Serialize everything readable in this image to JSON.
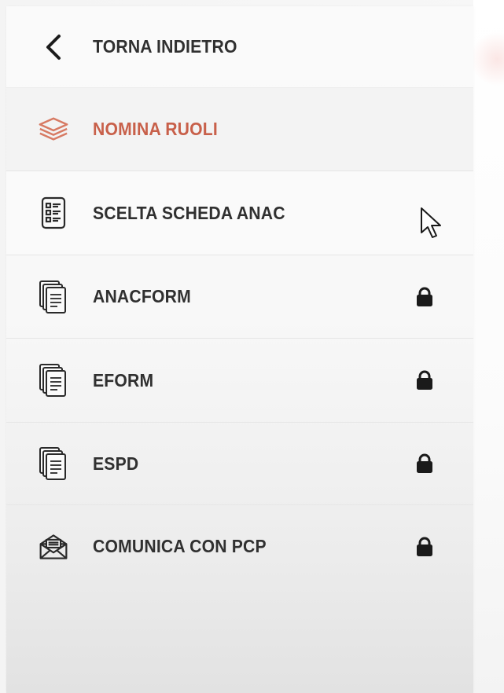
{
  "menu": {
    "back": {
      "label": "TORNA INDIETRO",
      "icon": "chevron-left-icon"
    },
    "items": [
      {
        "label": "NOMINA RUOLI",
        "icon": "layers-icon",
        "active": true,
        "locked": false
      },
      {
        "label": "SCELTA SCHEDA ANAC",
        "icon": "checklist-icon",
        "active": false,
        "locked": false
      },
      {
        "label": "ANACFORM",
        "icon": "documents-stack-icon",
        "active": false,
        "locked": true
      },
      {
        "label": "EFORM",
        "icon": "documents-stack-icon",
        "active": false,
        "locked": true
      },
      {
        "label": "ESPD",
        "icon": "documents-stack-icon",
        "active": false,
        "locked": true
      },
      {
        "label": "COMUNICA CON PCP",
        "icon": "envelope-open-icon",
        "active": false,
        "locked": true
      }
    ]
  },
  "colors": {
    "active_text": "#c8604a",
    "text": "#303030",
    "lock": "#1a1a1a"
  }
}
